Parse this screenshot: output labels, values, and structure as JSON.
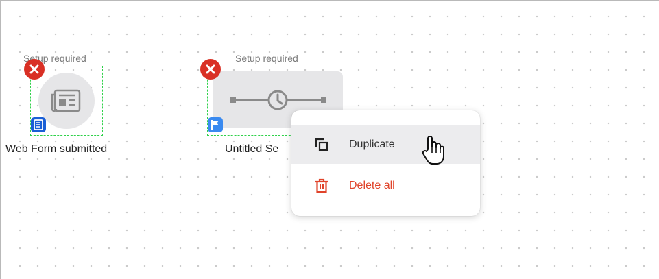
{
  "canvas": {
    "nodes": [
      {
        "setup_label": "Setup required",
        "title": "Web Form submitted",
        "icon": "newspaper-icon",
        "badge_icon": "form-icon"
      },
      {
        "setup_label": "Setup required",
        "title": "Untitled Se",
        "icon": "timer-sequence-icon",
        "badge_icon": "flag-icon"
      }
    ]
  },
  "context_menu": {
    "items": [
      {
        "label": "Duplicate",
        "icon": "duplicate-icon"
      },
      {
        "label": "Delete all",
        "icon": "trash-icon"
      }
    ]
  },
  "colors": {
    "remove": "#d93025",
    "selection": "#2fd14a",
    "delete_text": "#e0432a",
    "badge_form": "#1a5fd6",
    "badge_flag": "#3a8af0"
  }
}
